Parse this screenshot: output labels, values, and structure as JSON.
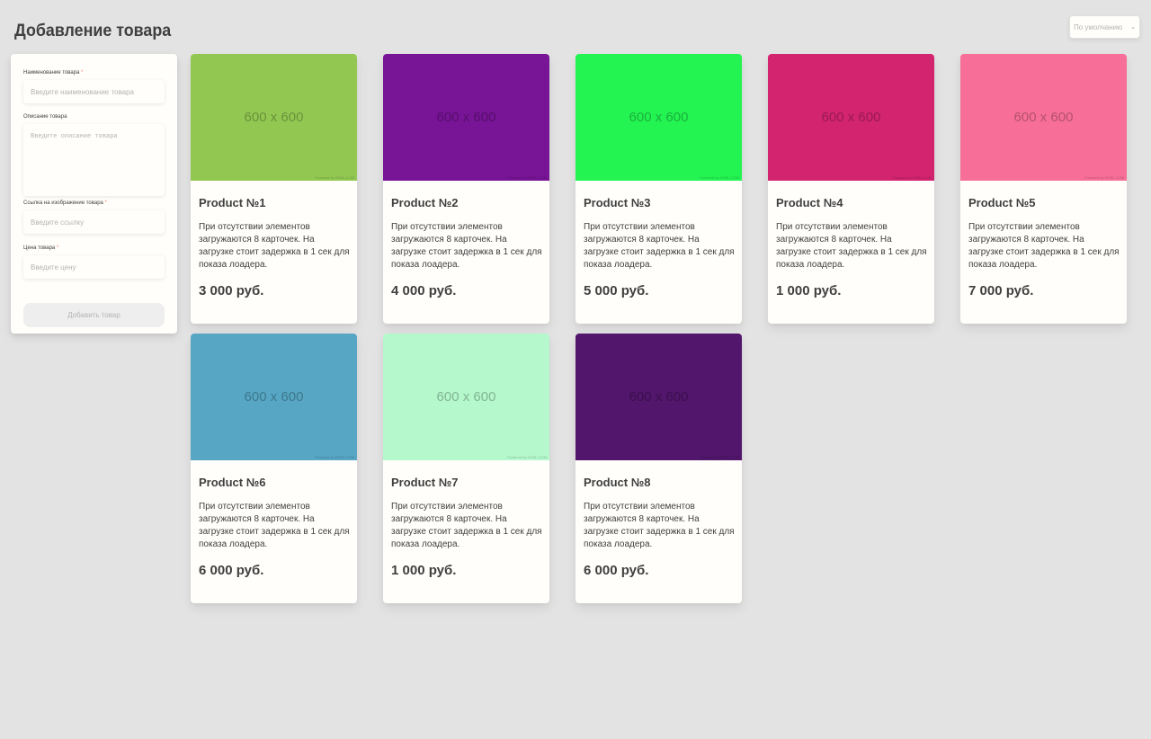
{
  "page": {
    "title": "Добавление товара"
  },
  "sort": {
    "selected": "По умолчанию"
  },
  "form": {
    "name_label": "Наименование товара",
    "name_placeholder": "Введите наименование товара",
    "desc_label": "Описание товара",
    "desc_placeholder": "Введите описание товара",
    "link_label": "Ссылка на изображение товара",
    "link_placeholder": "Введите ссылку",
    "price_label": "Цена товара",
    "price_placeholder": "Введите цену",
    "required_mark": "*",
    "submit_label": "Добавить товар"
  },
  "products": [
    {
      "name": "Product №1",
      "image_text": "600 x 600",
      "image_color": "#92c852",
      "description": "При отсутствии элементов загружаются 8 карточек. На загрузке стоит задержка в 1 сек для показа лоадера.",
      "price": "3 000 руб."
    },
    {
      "name": "Product №2",
      "image_text": "600 x 600",
      "image_color": "#781496",
      "description": "При отсутствии элементов загружаются 8 карточек. На загрузке стоит задержка в 1 сек для показа лоадера.",
      "price": "4 000 руб."
    },
    {
      "name": "Product №3",
      "image_text": "600 x 600",
      "image_color": "#24f452",
      "description": "При отсутствии элементов загружаются 8 карточек. На загрузке стоит задержка в 1 сек для показа лоадера.",
      "price": "5 000 руб."
    },
    {
      "name": "Product №4",
      "image_text": "600 x 600",
      "image_color": "#d32470",
      "description": "При отсутствии элементов загружаются 8 карточек. На загрузке стоит задержка в 1 сек для показа лоадера.",
      "price": "1 000 руб."
    },
    {
      "name": "Product №5",
      "image_text": "600 x 600",
      "image_color": "#f76f98",
      "description": "При отсутствии элементов загружаются 8 карточек. На загрузке стоит задержка в 1 сек для показа лоадера.",
      "price": "7 000 руб."
    },
    {
      "name": "Product №6",
      "image_text": "600 x 600",
      "image_color": "#56a6c4",
      "description": "При отсутствии элементов загружаются 8 карточек. На загрузке стоит задержка в 1 сек для показа лоадера.",
      "price": "6 000 руб."
    },
    {
      "name": "Product №7",
      "image_text": "600 x 600",
      "image_color": "#b4f8cc",
      "description": "При отсутствии элементов загружаются 8 карточек. На загрузке стоит задержка в 1 сек для показа лоадера.",
      "price": "1 000 руб."
    },
    {
      "name": "Product №8",
      "image_text": "600 x 600",
      "image_color": "#52166c",
      "description": "При отсутствии элементов загружаются 8 карточек. На загрузке стоит задержка в 1 сек для показа лоадера.",
      "price": "6 000 руб."
    }
  ]
}
